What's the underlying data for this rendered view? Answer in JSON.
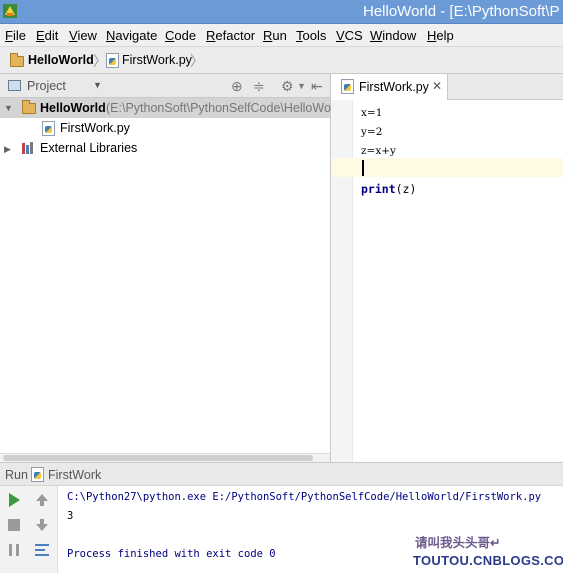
{
  "window": {
    "title": "HelloWorld - [E:\\PythonSoft\\P"
  },
  "menu": [
    "File",
    "Edit",
    "View",
    "Navigate",
    "Code",
    "Refactor",
    "Run",
    "Tools",
    "VCS",
    "Window",
    "Help"
  ],
  "breadcrumb": {
    "project": "HelloWorld",
    "file": "FirstWork.py"
  },
  "project_panel": {
    "label": "Project",
    "root": "HelloWorld",
    "root_path": "(E:\\PythonSoft\\PythonSelfCode\\HelloWor",
    "file": "FirstWork.py",
    "libraries": "External Libraries"
  },
  "editor": {
    "tab": "FirstWork.py",
    "lines": [
      "x=1",
      "y=2",
      "z=x+y",
      "",
      "print(z)"
    ],
    "print_kw": "print",
    "print_args": "(z)"
  },
  "run": {
    "label": "Run",
    "config": "FirstWork",
    "console": [
      "C:\\Python27\\python.exe E:/PythonSoft/PythonSelfCode/HelloWorld/FirstWork.py",
      "3",
      "",
      "Process finished with exit code 0"
    ]
  },
  "watermark": {
    "line1": "请叫我头头哥↵",
    "line2": "TOUTOU.CNBLOGS.COM"
  }
}
